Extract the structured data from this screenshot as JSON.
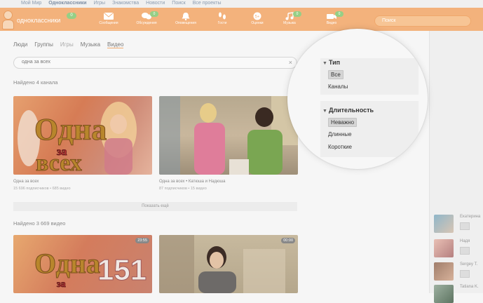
{
  "top_links": [
    "Мой Мир",
    "Одноклассники",
    "Игры",
    "Знакомства",
    "Новости",
    "Поиск",
    "Все проекты"
  ],
  "header": {
    "brand": "одноклассники",
    "brand_badge": "0",
    "nav": [
      {
        "label": "Сообщения",
        "icon": "envelope-icon",
        "badge": ""
      },
      {
        "label": "Обсуждения",
        "icon": "chat-icon",
        "badge": "0"
      },
      {
        "label": "Оповещения",
        "icon": "bell-icon",
        "badge": ""
      },
      {
        "label": "Гости",
        "icon": "footprints-icon",
        "badge": ""
      },
      {
        "label": "Оценки",
        "icon": "rating-icon",
        "badge": ""
      },
      {
        "label": "Музыка",
        "icon": "music-icon",
        "badge": "0"
      },
      {
        "label": "Видео",
        "icon": "camera-icon",
        "badge": "0"
      }
    ],
    "search_placeholder": "Поиск"
  },
  "tabs": [
    {
      "label": "Люди",
      "state": "normal"
    },
    {
      "label": "Группы",
      "state": "normal"
    },
    {
      "label": "Игры",
      "state": "dim"
    },
    {
      "label": "Музыка",
      "state": "normal"
    },
    {
      "label": "Видео",
      "state": "active"
    }
  ],
  "query": "одна за всех",
  "found_channels": "Найдено 4 канала",
  "channels": [
    {
      "title": "Одна за всех",
      "sub": "15 696 подписчиков • 685 видео"
    },
    {
      "title": "Одна за всех • Катюша и Надюша",
      "sub": "87 подписчиков • 15 видео"
    }
  ],
  "show_more": "Показать ещё",
  "found_videos": "Найдено 3 669 видео",
  "videos": [
    {
      "duration": "23:55",
      "thumb_text": "151"
    },
    {
      "duration": "00:00"
    }
  ],
  "thumb_logo": {
    "line1": "Одна",
    "line2": "за",
    "line3": "всех"
  },
  "filters": {
    "type_title": "Тип",
    "type_options": [
      "Все",
      "Каналы"
    ],
    "duration_title": "Длительность",
    "duration_options": [
      "Неважно",
      "Длинные",
      "Короткие"
    ]
  },
  "friends": [
    {
      "name": "Екатерина"
    },
    {
      "name": "Надя"
    },
    {
      "name": "Sergey T."
    },
    {
      "name": "Tatiana K."
    }
  ]
}
